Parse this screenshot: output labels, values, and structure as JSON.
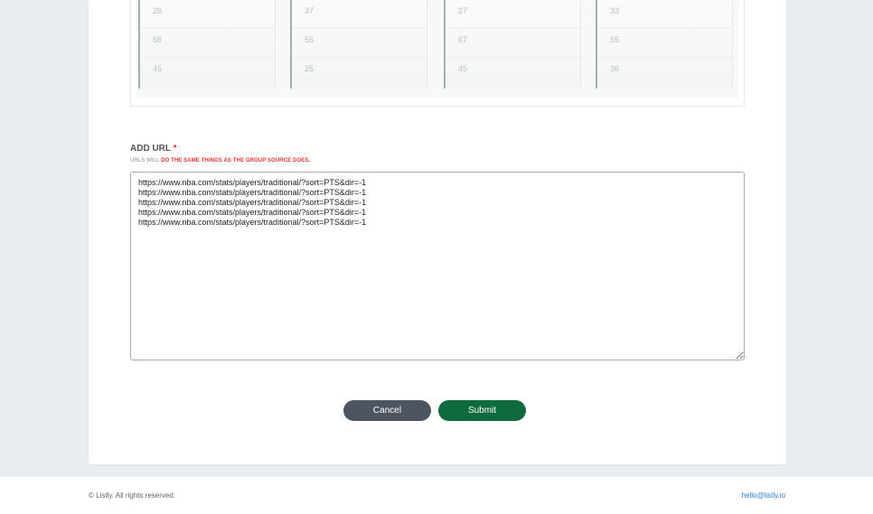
{
  "preview": {
    "columns": [
      {
        "cells": [
          "28",
          "68",
          "45"
        ]
      },
      {
        "cells": [
          "37",
          "56",
          "25"
        ]
      },
      {
        "cells": [
          "27",
          "67",
          "45"
        ]
      },
      {
        "cells": [
          "33",
          "55",
          "36"
        ]
      }
    ]
  },
  "add_url": {
    "title": "ADD URL",
    "required_mark": "*",
    "hint_prefix": "URLS WILL ",
    "hint_emphasis": "DO THE SAME THINGS AS THE GROUP SOURCE DOES.",
    "value": "https://www.nba.com/stats/players/traditional/?sort=PTS&dir=-1\nhttps://www.nba.com/stats/players/traditional/?sort=PTS&dir=-1\nhttps://www.nba.com/stats/players/traditional/?sort=PTS&dir=-1\nhttps://www.nba.com/stats/players/traditional/?sort=PTS&dir=-1\nhttps://www.nba.com/stats/players/traditional/?sort=PTS&dir=-1"
  },
  "buttons": {
    "cancel": "Cancel",
    "submit": "Submit"
  },
  "footer": {
    "copyright": "© Listly. All rights reserved.",
    "email": "hello@listly.io"
  },
  "colors": {
    "background": "#e9edf0",
    "required": "#e3342f",
    "cancel_button": "#4d5560",
    "submit_button": "#0f6a3d",
    "link": "#2d7ad6"
  }
}
